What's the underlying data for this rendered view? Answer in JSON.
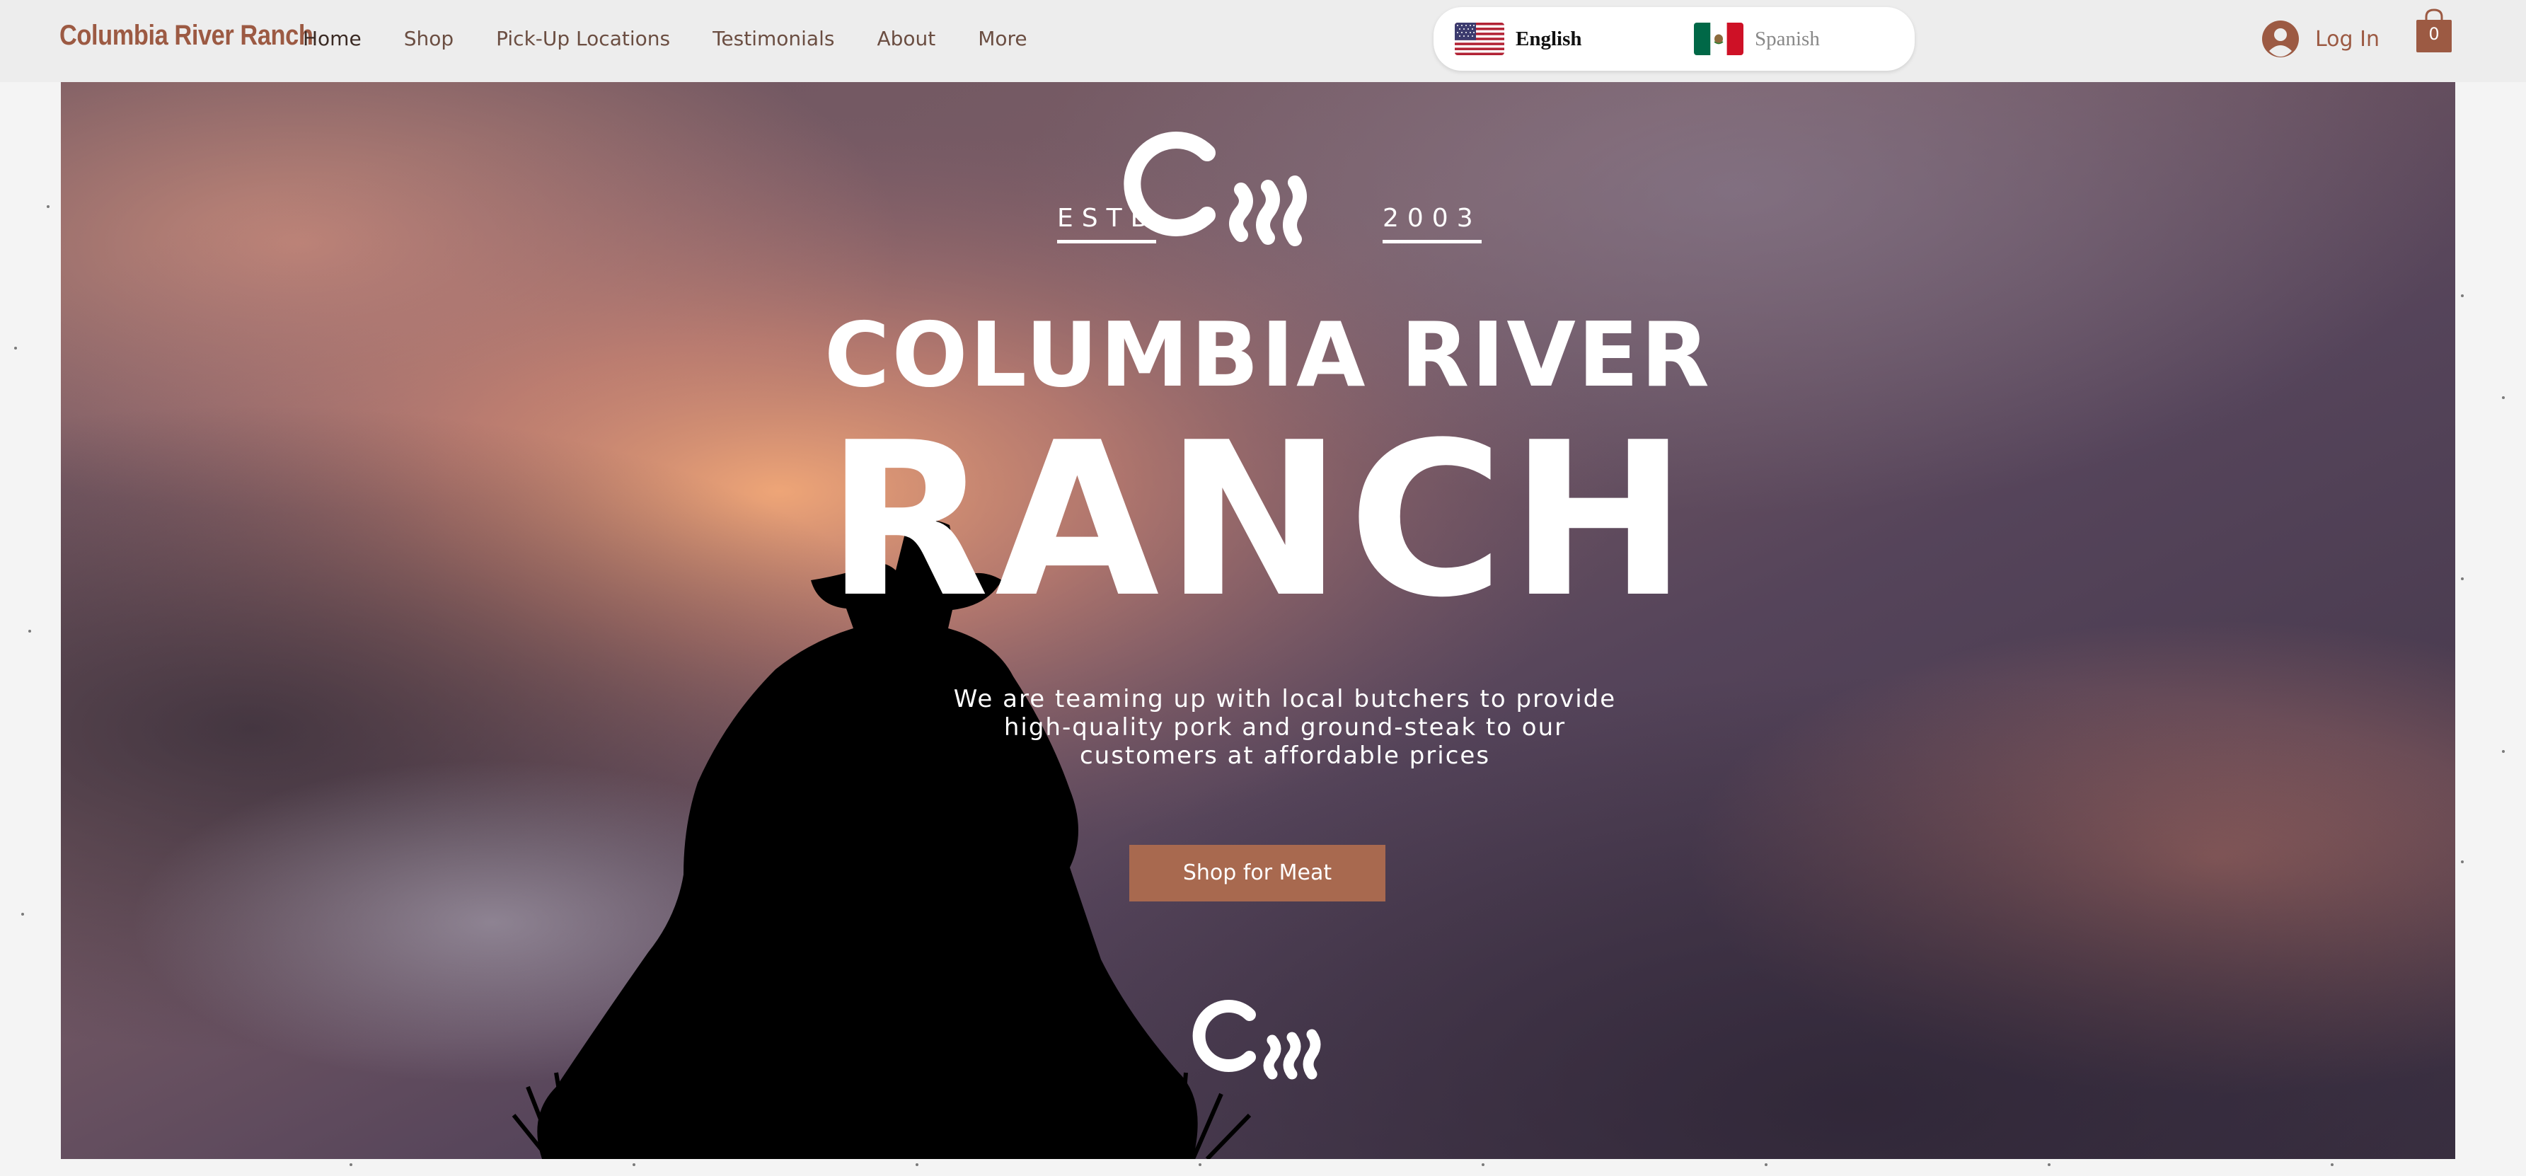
{
  "header": {
    "brand": "Columbia River Ranch",
    "nav": [
      {
        "label": "Home"
      },
      {
        "label": "Shop"
      },
      {
        "label": "Pick-Up Locations"
      },
      {
        "label": "Testimonials"
      },
      {
        "label": "About"
      },
      {
        "label": "More"
      }
    ],
    "languages": {
      "english": "English",
      "spanish": "Spanish",
      "selected": "English"
    },
    "login_label": "Log In",
    "cart_count": "0"
  },
  "hero": {
    "estb": "ESTB",
    "year": "2003",
    "title_line1": "COLUMBIA RIVER",
    "title_line2": "RANCH",
    "tagline": "We are teaming up with local butchers to provide high-quality pork and ground-steak to our customers at affordable prices",
    "cta_label": "Shop for Meat"
  },
  "colors": {
    "brand": "#9c5a43",
    "button": "#a8694f",
    "header_bg": "#ededed"
  },
  "icons": [
    "us-flag-icon",
    "mexico-flag-icon",
    "user-avatar-icon",
    "shopping-bag-icon",
    "crr-logo-icon"
  ]
}
